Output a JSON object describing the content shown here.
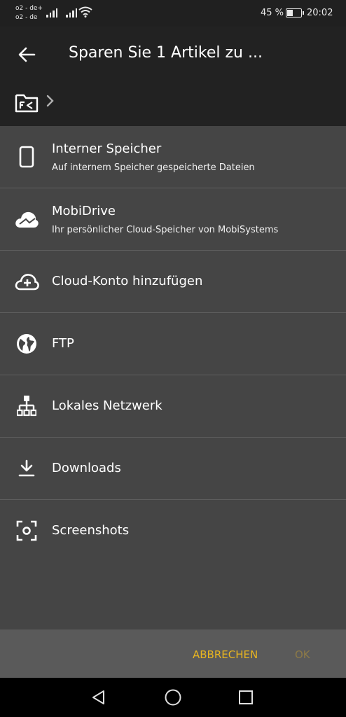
{
  "status_bar": {
    "carrier_1": "o2 - de+",
    "carrier_2": "o2 - de",
    "battery_percent": "45 %",
    "time": "20:02"
  },
  "toolbar": {
    "title": "Sparen Sie 1 Artikel zu ...",
    "back_icon": "arrow-left-icon",
    "folder_icon": "folder-fc-icon"
  },
  "locations": [
    {
      "label": "Interner Speicher",
      "subtitle": "Auf internem Speicher gespeicherte Dateien",
      "icon": "phone-icon"
    },
    {
      "label": "MobiDrive",
      "subtitle": "Ihr persönlicher Cloud-Speicher von MobiSystems",
      "icon": "cloud-icon"
    },
    {
      "label": "Cloud-Konto hinzufügen",
      "icon": "cloud-add-icon"
    },
    {
      "label": "FTP",
      "icon": "globe-icon"
    },
    {
      "label": "Lokales Netzwerk",
      "icon": "network-icon"
    },
    {
      "label": "Downloads",
      "icon": "download-icon"
    },
    {
      "label": "Screenshots",
      "icon": "screenshot-icon"
    }
  ],
  "footer": {
    "cancel_label": "ABBRECHEN",
    "ok_label": "OK"
  },
  "colors": {
    "accent": "#e8b520",
    "accent_disabled": "#8d7a47",
    "toolbar_bg": "#222222",
    "list_bg": "#454545"
  }
}
